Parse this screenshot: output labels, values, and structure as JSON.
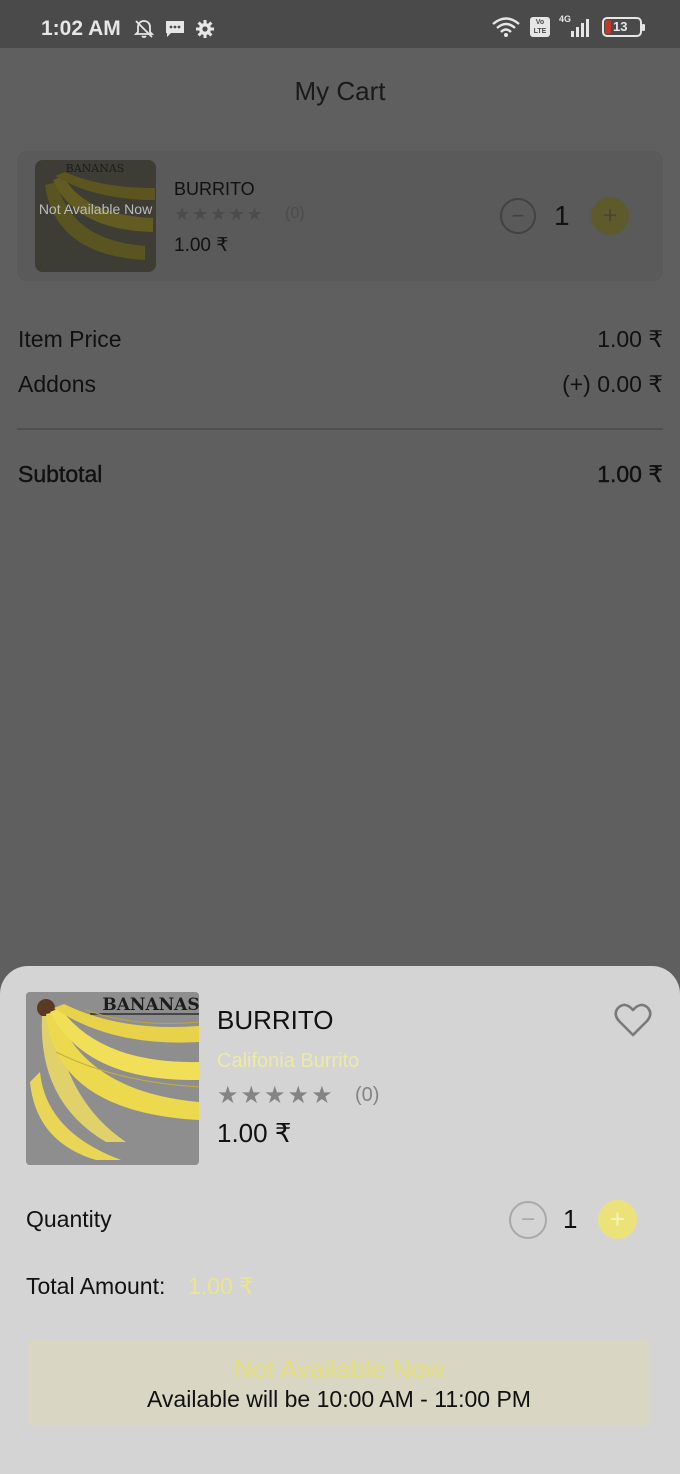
{
  "status_bar": {
    "time": "1:02 AM",
    "network": "4G",
    "volte": "Vo LTE",
    "battery": "13"
  },
  "header": {
    "title": "My Cart"
  },
  "cart_item": {
    "name": "BURRITO",
    "image_text": "BANANAS",
    "availability_overlay": "Not Available Now",
    "stars": "★★★★★",
    "rating_count": "(0)",
    "price": "1.00 ₹",
    "quantity": "1",
    "minus_symbol": "−",
    "plus_symbol": "+"
  },
  "summary": {
    "item_price_label": "Item Price",
    "item_price_value": "1.00 ₹",
    "addons_label": "Addons",
    "addons_value": "(+) 0.00 ₹",
    "subtotal_label": "Subtotal",
    "subtotal_value": "1.00 ₹"
  },
  "sheet": {
    "image_text": "BANANAS",
    "name": "BURRITO",
    "subtitle": "Califonia Burrito",
    "stars": "★★★★★",
    "rating_count": "(0)",
    "price": "1.00 ₹",
    "quantity_label": "Quantity",
    "quantity": "1",
    "minus_symbol": "−",
    "plus_symbol": "+",
    "total_label": "Total Amount:",
    "total_value": "1.00 ₹",
    "unavailable_title": "Not Available Now",
    "availability_hours": "Available will be 10:00 AM - 11:00 PM"
  },
  "colors": {
    "accent_yellow": "#ebe37a",
    "overlay_gray": "#5f5f5f",
    "sheet_bg": "#d4d4d4"
  }
}
